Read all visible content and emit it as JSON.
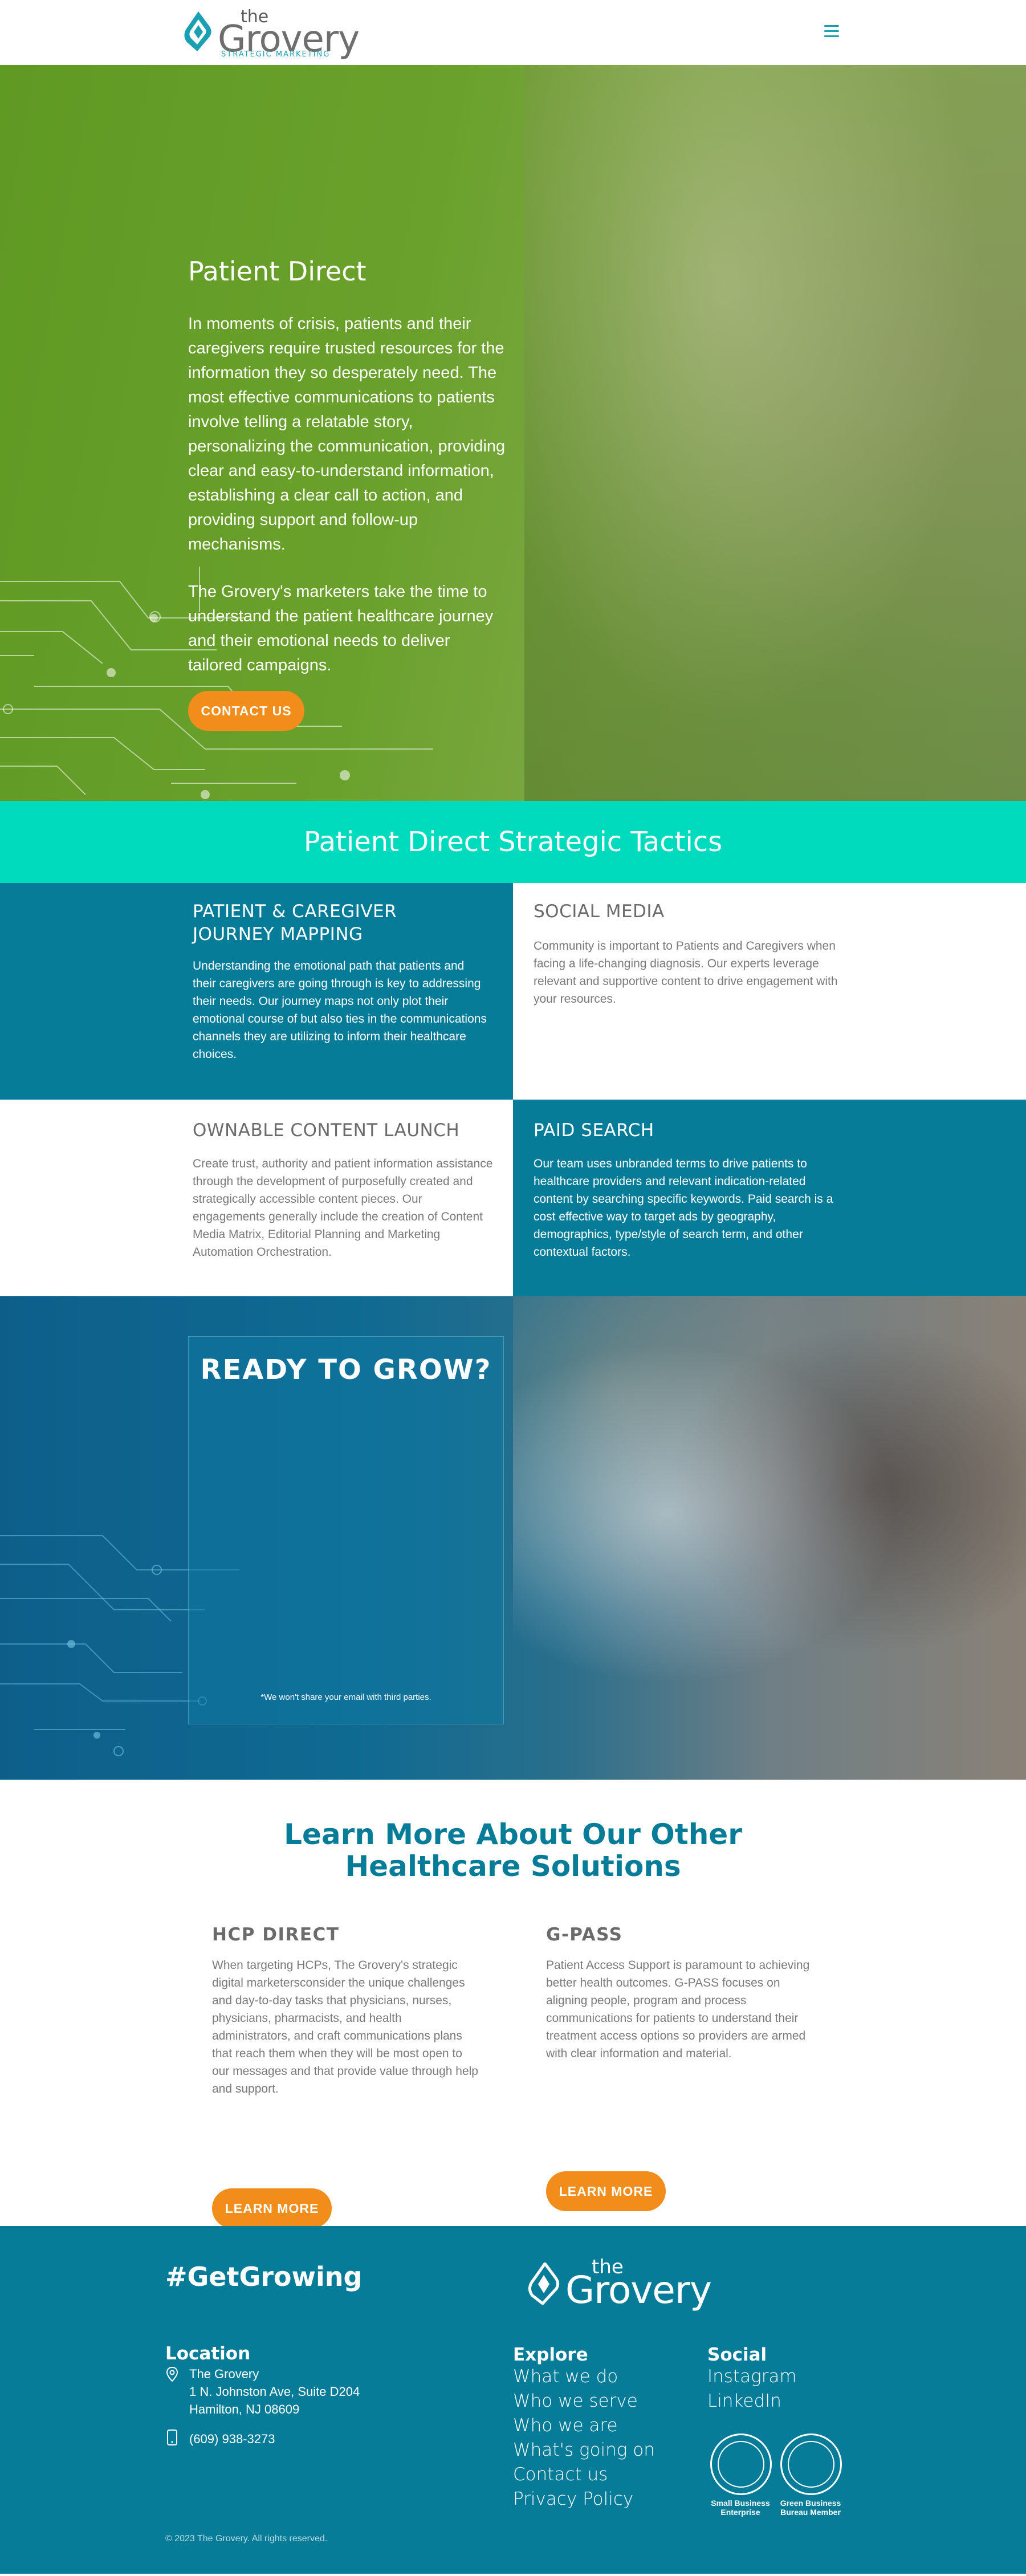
{
  "header": {
    "logo_the": "the",
    "logo_name": "Grovery",
    "logo_tagline": "STRATEGIC MARKETING",
    "menu_icon": "hamburger-menu-icon",
    "accent": "#1aa0b3"
  },
  "hero": {
    "title": "Patient Direct",
    "paragraph1": "In moments of crisis, patients and their caregivers require trusted resources for the information they so desperately need. The most effective communications to patients involve telling a relatable story, personalizing the communication, providing clear and easy-to-understand information, establishing a clear call to action, and providing support and follow-up mechanisms.",
    "paragraph2": "The Grovery's marketers take the time to understand the patient healthcare journey and their emotional needs to deliver tailored campaigns.",
    "cta": "CONTACT US",
    "bg_color": "#6aa12c",
    "button_color": "#f28c1a"
  },
  "tactics": {
    "title": "Patient Direct Strategic Tactics",
    "band_color": "#00dbbe",
    "items": [
      {
        "title": "PATIENT & CAREGIVER JOURNEY MAPPING",
        "body": "Understanding the emotional path that patients and their caregivers are going through is key to addressing their needs. Our journey maps not only plot their emotional course of but also ties in the communications channels they are utilizing to inform their healthcare choices."
      },
      {
        "title": "SOCIAL MEDIA",
        "body": "Community is important to Patients and Caregivers when facing a life-changing diagnosis. Our experts leverage relevant and supportive content to drive engagement with your resources."
      },
      {
        "title": "OWNABLE CONTENT LAUNCH",
        "body": "Create trust, authority and patient information assistance through the development of purposefully created and strategically accessible content pieces. Our engagements generally include the creation of Content Media Matrix, Editorial Planning and Marketing Automation Orchestration."
      },
      {
        "title": "PAID SEARCH",
        "body": "Our team uses unbranded terms to drive patients to healthcare providers and relevant indication-related content by searching specific keywords. Paid search is a cost effective way to target ads by geography, demographics, type/style of search term, and other contextual factors."
      }
    ],
    "teal_color": "#067c99"
  },
  "ready": {
    "title": "READY TO GROW?",
    "note": "*We won't share your email with third parties."
  },
  "learn": {
    "title_line1": "Learn More About Our Other",
    "title_line2": "Healthcare Solutions",
    "solutions": [
      {
        "title": "HCP DIRECT",
        "body": "When targeting HCPs, The Grovery's strategic digital marketersconsider the unique challenges and day-to-day tasks that physicians, nurses, physicians, pharmacists, and health administrators, and craft communications plans that reach them when they will be most open to our messages and that provide value through help and support.",
        "cta": "LEARN MORE"
      },
      {
        "title": "G-PASS",
        "body": "Patient Access Support is paramount to achieving better health outcomes. G-PASS focuses on aligning people, program and process communications for patients to understand their treatment access options so providers are armed with clear information and material.",
        "cta": "LEARN MORE"
      }
    ]
  },
  "footer": {
    "hashtag": "#GetGrowing",
    "logo_the": "the",
    "logo_name": "Grovery",
    "location": {
      "heading": "Location",
      "name": "The Grovery",
      "address1": "1 N. Johnston Ave, Suite D204",
      "address2": "Hamilton, NJ 08609",
      "phone": "(609) 938-3273"
    },
    "explore": {
      "heading": "Explore",
      "links": [
        "What we do",
        "Who we serve",
        "Who we are",
        "What's going on",
        "Contact us",
        "Privacy Policy"
      ]
    },
    "social": {
      "heading": "Social",
      "links": [
        "Instagram",
        "LinkedIn"
      ],
      "badges": [
        "Small Business Enterprise",
        "Green Business Bureau Member"
      ]
    },
    "copyright": "© 2023 The Grovery. All rights reserved.",
    "bg_color": "#067c99"
  }
}
